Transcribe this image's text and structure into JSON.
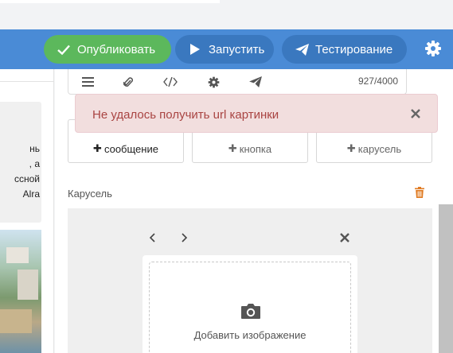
{
  "header": {
    "publish_label": "Опубликовать",
    "run_label": "Запустить",
    "test_label": "Тестирование",
    "publish_color": "#5cb85c",
    "header_color": "#4a8bd6"
  },
  "left_card": {
    "lines": [
      "нь",
      ", а",
      "ссной",
      "Alra"
    ]
  },
  "toolbar": {
    "counter": "927/4000",
    "icons": [
      "menu-icon",
      "paperclip-icon",
      "code-icon",
      "gear-icon",
      "send-icon"
    ]
  },
  "cards": {
    "message_label": "сообщение",
    "button_label": "кнопка",
    "carousel_label": "карусель"
  },
  "section": {
    "carousel_title": "Карусель"
  },
  "carousel": {
    "add_image_label": "Добавить изображение"
  },
  "alert": {
    "message": "Не удалось получить url картинки"
  }
}
